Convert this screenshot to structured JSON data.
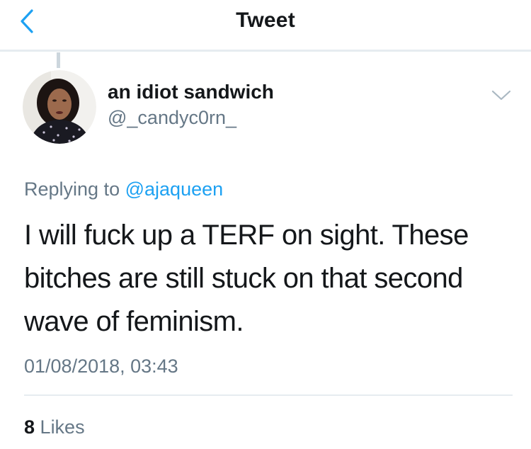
{
  "header": {
    "title": "Tweet",
    "back_icon": "chevron-left-icon"
  },
  "colors": {
    "accent": "#1da1f2",
    "text_primary": "#14171a",
    "text_secondary": "#657786",
    "divider": "#e6ecf0"
  },
  "tweet": {
    "author": {
      "display_name": "an idiot sandwich",
      "handle": "@_candyc0rn_",
      "avatar_icon": "avatar-photo"
    },
    "menu_icon": "chevron-down-icon",
    "reply_context": {
      "prefix": "Replying to",
      "mention": "@ajaqueen"
    },
    "text": "I will fuck up a TERF on sight. These bitches are still stuck on that second wave of feminism.",
    "timestamp": "01/08/2018, 03:43",
    "stats": {
      "likes_count": "8",
      "likes_label": "Likes"
    }
  }
}
